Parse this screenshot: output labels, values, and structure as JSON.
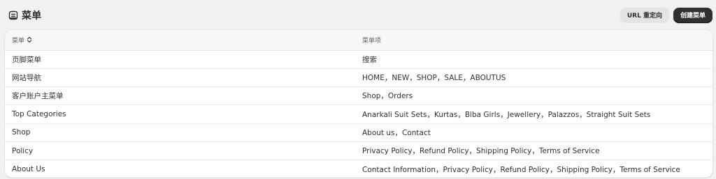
{
  "header": {
    "title": "菜单",
    "icon": "menu-icon",
    "url_redirect_label": "URL 重定向",
    "create_menu_label": "创建菜单"
  },
  "table": {
    "columns": [
      "菜单",
      "菜单项"
    ],
    "sort_icon": "sort-icon",
    "rows": [
      {
        "menu": "页脚菜单",
        "items": "搜索"
      },
      {
        "menu": "网站导航",
        "items": "HOME，NEW，SHOP，SALE，ABOUTUS"
      },
      {
        "menu": "客户账户主菜单",
        "items": "Shop，Orders"
      },
      {
        "menu": "Top Categories",
        "items": "Anarkali Suit Sets，Kurtas，Biba Girls，Jewellery，Palazzos，Straight Suit Sets"
      },
      {
        "menu": "Shop",
        "items": "About us，Contact"
      },
      {
        "menu": "Policy",
        "items": "Privacy Policy，Refund Policy，Shipping Policy，Terms of Service"
      },
      {
        "menu": "About Us",
        "items": "Contact Information，Privacy Policy，Refund Policy，Shipping Policy，Terms of Service"
      }
    ]
  },
  "colors": {
    "page_bg": "#f1f1f1",
    "primary_button": "#303030",
    "secondary_button": "#e3e3e3",
    "text": "#303030"
  }
}
